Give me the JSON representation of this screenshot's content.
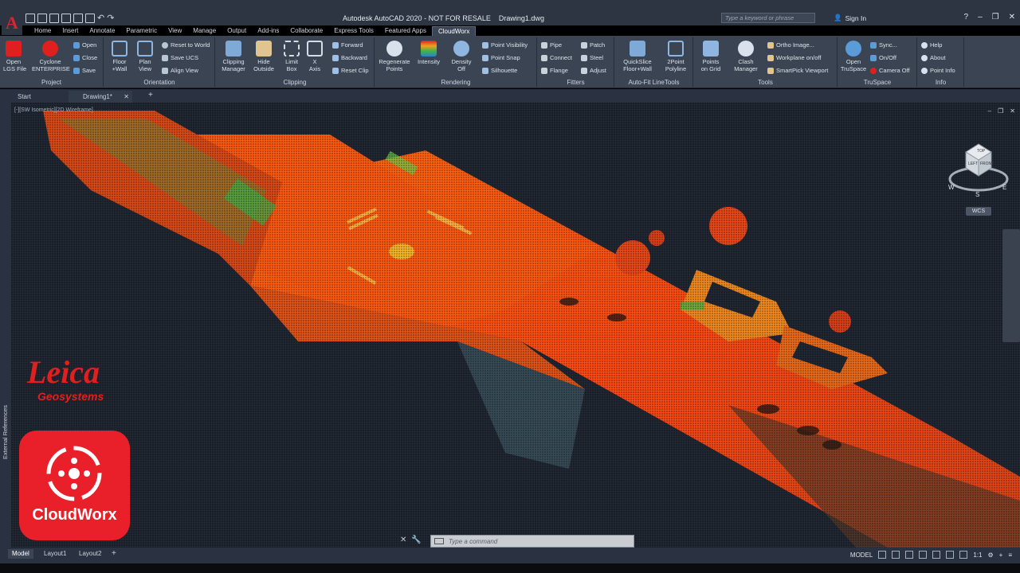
{
  "app": {
    "title": "Autodesk AutoCAD 2020 - NOT FOR RESALE    Drawing1.dwg",
    "app_letter": "A",
    "search_placeholder": "Type a keyword or phrase",
    "sign_in": "Sign In"
  },
  "menu_tabs": [
    "Home",
    "Insert",
    "Annotate",
    "Parametric",
    "View",
    "Manage",
    "Output",
    "Add-ins",
    "Collaborate",
    "Express Tools",
    "Featured Apps",
    "CloudWorx"
  ],
  "active_tab": "CloudWorx",
  "ribbon": {
    "project": {
      "label": "Project",
      "open_lgs": "Open\nLGS File",
      "cyclone": "Cyclone\nENTERPRISE",
      "open": "Open",
      "close": "Close",
      "save": "Save"
    },
    "orientation": {
      "label": "Orientation",
      "floor_wall": "Floor\n+Wall",
      "plan_view": "Plan\nView",
      "reset_world": "Reset to World",
      "save_ucs": "Save UCS",
      "align_view": "Align View"
    },
    "clipping": {
      "label": "Clipping",
      "manager": "Clipping\nManager",
      "hide_outside": "Hide\nOutside",
      "limit_box": "Limit\nBox",
      "x_axis": "X\nAxis",
      "forward": "Forward",
      "backward": "Backward",
      "reset_clip": "Reset Clip"
    },
    "rendering": {
      "label": "Rendering",
      "regenerate": "Regenerate\nPoints",
      "intensity": "Intensity",
      "density_off": "Density\nOff",
      "point_visibility": "Point Visibility",
      "point_snap": "Point Snap",
      "silhouette": "Silhouette"
    },
    "fitters": {
      "label": "Fitters",
      "pipe": "Pipe",
      "connect": "Connect",
      "flange": "Flange",
      "patch": "Patch",
      "steel": "Steel",
      "adjust": "Adjust"
    },
    "autofit": {
      "label": "Auto-Fit LineTools",
      "quickslice": "QuickSlice\nFloor+Wall",
      "polyline": "2Point\nPolyline"
    },
    "tools": {
      "label": "Tools",
      "points_on_grid": "Points\non Grid",
      "clash": "Clash\nManager",
      "ortho": "Ortho Image...",
      "workplane": "Workplane on/off",
      "smartpick": "SmartPick Viewport"
    },
    "truspace": {
      "label": "TruSpace",
      "open": "Open\nTruSpace",
      "sync": "Sync...",
      "onoff": "On/Off",
      "camera_off": "Camera Off"
    },
    "info": {
      "label": "Info",
      "help": "Help",
      "about": "About",
      "point_info": "Point Info"
    }
  },
  "doc_tabs": {
    "start": "Start",
    "drawing": "Drawing1*"
  },
  "viewport": {
    "label": "[-][SW Isometric][2D Wireframe]",
    "wcs": "WCS",
    "side_panel": "External References"
  },
  "viewcube": {
    "left": "LEFT",
    "front": "FRONT",
    "top": "TOP",
    "w": "W",
    "s": "S",
    "e": "E"
  },
  "command": {
    "placeholder": "Type a command"
  },
  "layouts": [
    "Model",
    "Layout1",
    "Layout2"
  ],
  "status": {
    "model": "MODEL",
    "scale": "1:1"
  },
  "branding": {
    "leica": "Leica",
    "geosystems": "Geosystems",
    "cloudworx": "CloudWorx"
  },
  "colors": {
    "accent": "#e0201f",
    "ribbon": "#3b4453",
    "viewport": "#212733"
  }
}
